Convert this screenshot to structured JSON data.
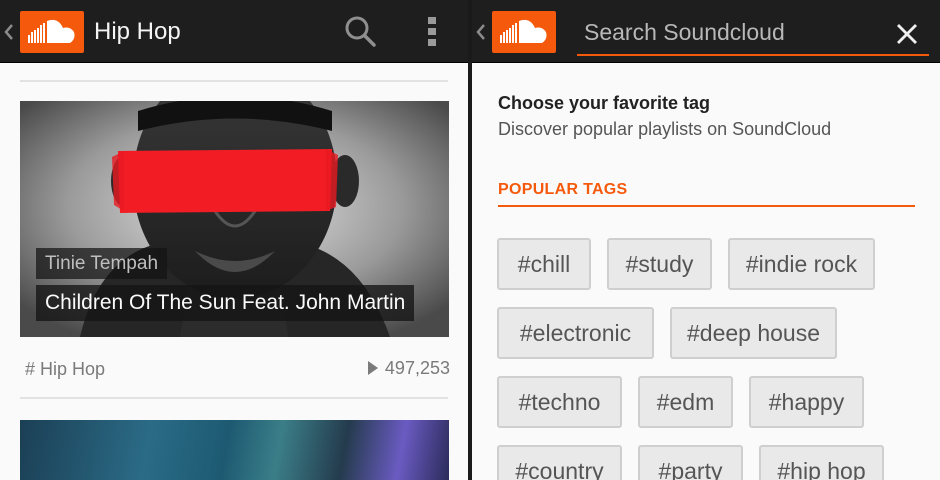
{
  "left": {
    "title": "Hip Hop",
    "icons": [
      "up-caret-icon",
      "soundcloud-logo",
      "search-icon",
      "overflow-menu-icon"
    ],
    "track": {
      "artist": "Tinie Tempah",
      "title": "Children Of The Sun Feat. John Martin",
      "genre": "# Hip Hop",
      "plays": "497,253"
    }
  },
  "right": {
    "search": {
      "placeholder": "Search Soundcloud",
      "value": ""
    },
    "heading": "Choose your favorite tag",
    "subheading": "Discover popular playlists on SoundCloud",
    "section_title": "POPULAR TAGS",
    "tags": [
      "#chill",
      "#study",
      "#indie rock",
      "#electronic",
      "#deep house",
      "#techno",
      "#edm",
      "#happy",
      "#country",
      "#party",
      "#hip hop"
    ]
  },
  "colors": {
    "accent": "#f55a0c",
    "actionbar": "#1e1e1e",
    "chip": "#e9e9e9"
  }
}
